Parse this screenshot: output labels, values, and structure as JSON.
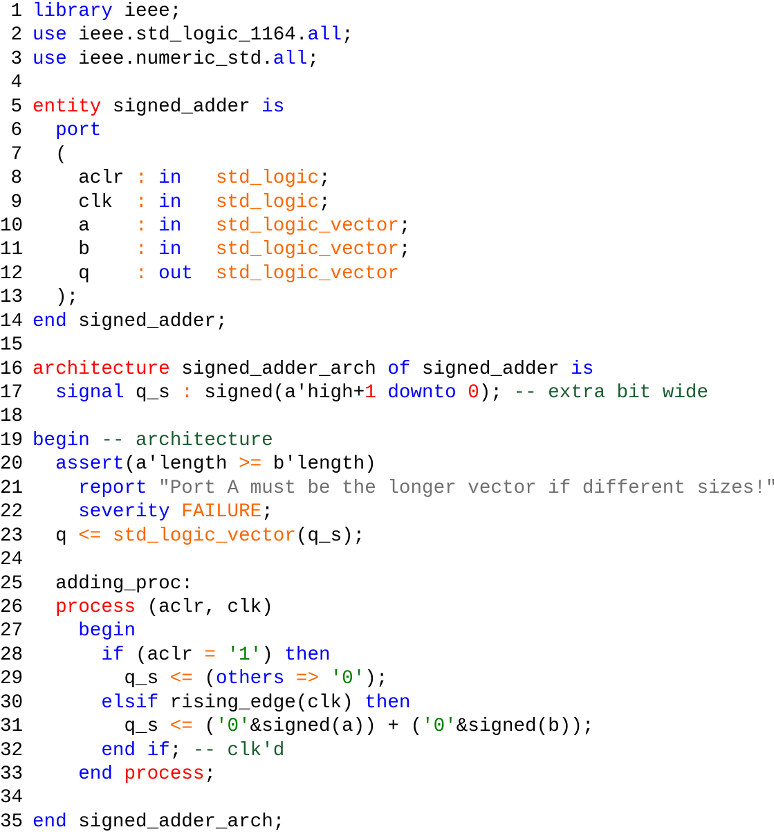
{
  "editor": {
    "language": "VHDL",
    "colors": {
      "keyword": "#0000ff",
      "design_unit_keyword": "#ff0000",
      "type": "#ff6600",
      "operator": "#ff6600",
      "number": "#ff0000",
      "comment": "#1a5c2e",
      "string": "#707070",
      "char_literal": "#008000",
      "plain": "#000000"
    },
    "lines": [
      {
        "n": "1",
        "tokens": [
          [
            "kw",
            "library"
          ],
          [
            "id",
            " ieee;"
          ]
        ]
      },
      {
        "n": "2",
        "tokens": [
          [
            "kw",
            "use"
          ],
          [
            "id",
            " ieee.std_logic_1164."
          ],
          [
            "kw",
            "all"
          ],
          [
            "id",
            ";"
          ]
        ]
      },
      {
        "n": "3",
        "tokens": [
          [
            "kw",
            "use"
          ],
          [
            "id",
            " ieee.numeric_std."
          ],
          [
            "kw",
            "all"
          ],
          [
            "id",
            ";"
          ]
        ]
      },
      {
        "n": "4",
        "tokens": []
      },
      {
        "n": "5",
        "tokens": [
          [
            "kw2",
            "entity"
          ],
          [
            "id",
            " signed_adder "
          ],
          [
            "kw",
            "is"
          ]
        ]
      },
      {
        "n": "6",
        "tokens": [
          [
            "id",
            "  "
          ],
          [
            "kw",
            "port"
          ]
        ]
      },
      {
        "n": "7",
        "tokens": [
          [
            "id",
            "  ("
          ]
        ]
      },
      {
        "n": "8",
        "tokens": [
          [
            "id",
            "    aclr "
          ],
          [
            "op",
            ":"
          ],
          [
            "id",
            " "
          ],
          [
            "kw",
            "in"
          ],
          [
            "id",
            "   "
          ],
          [
            "ty",
            "std_logic"
          ],
          [
            "id",
            ";"
          ]
        ]
      },
      {
        "n": "9",
        "tokens": [
          [
            "id",
            "    clk  "
          ],
          [
            "op",
            ":"
          ],
          [
            "id",
            " "
          ],
          [
            "kw",
            "in"
          ],
          [
            "id",
            "   "
          ],
          [
            "ty",
            "std_logic"
          ],
          [
            "id",
            ";"
          ]
        ]
      },
      {
        "n": "10",
        "tokens": [
          [
            "id",
            "    a    "
          ],
          [
            "op",
            ":"
          ],
          [
            "id",
            " "
          ],
          [
            "kw",
            "in"
          ],
          [
            "id",
            "   "
          ],
          [
            "ty",
            "std_logic_vector"
          ],
          [
            "id",
            ";"
          ]
        ]
      },
      {
        "n": "11",
        "tokens": [
          [
            "id",
            "    b    "
          ],
          [
            "op",
            ":"
          ],
          [
            "id",
            " "
          ],
          [
            "kw",
            "in"
          ],
          [
            "id",
            "   "
          ],
          [
            "ty",
            "std_logic_vector"
          ],
          [
            "id",
            ";"
          ]
        ]
      },
      {
        "n": "12",
        "tokens": [
          [
            "id",
            "    q    "
          ],
          [
            "op",
            ":"
          ],
          [
            "id",
            " "
          ],
          [
            "kw",
            "out"
          ],
          [
            "id",
            "  "
          ],
          [
            "ty",
            "std_logic_vector"
          ]
        ]
      },
      {
        "n": "13",
        "tokens": [
          [
            "id",
            "  );"
          ]
        ]
      },
      {
        "n": "14",
        "tokens": [
          [
            "kw",
            "end"
          ],
          [
            "id",
            " signed_adder;"
          ]
        ]
      },
      {
        "n": "15",
        "tokens": []
      },
      {
        "n": "16",
        "tokens": [
          [
            "kw2",
            "architecture"
          ],
          [
            "id",
            " signed_adder_arch "
          ],
          [
            "kw",
            "of"
          ],
          [
            "id",
            " signed_adder "
          ],
          [
            "kw",
            "is"
          ]
        ]
      },
      {
        "n": "17",
        "tokens": [
          [
            "id",
            "  "
          ],
          [
            "kw",
            "signal"
          ],
          [
            "id",
            " q_s "
          ],
          [
            "op",
            ":"
          ],
          [
            "id",
            " signed(a'high+"
          ],
          [
            "num",
            "1"
          ],
          [
            "id",
            " "
          ],
          [
            "kw",
            "downto"
          ],
          [
            "id",
            " "
          ],
          [
            "num",
            "0"
          ],
          [
            "id",
            "); "
          ],
          [
            "cm",
            "-- extra bit wide"
          ]
        ]
      },
      {
        "n": "18",
        "tokens": []
      },
      {
        "n": "19",
        "tokens": [
          [
            "kw",
            "begin"
          ],
          [
            "id",
            " "
          ],
          [
            "cm",
            "-- architecture"
          ]
        ]
      },
      {
        "n": "20",
        "tokens": [
          [
            "id",
            "  "
          ],
          [
            "kw",
            "assert"
          ],
          [
            "id",
            "(a'length "
          ],
          [
            "op",
            ">="
          ],
          [
            "id",
            " b'length)"
          ]
        ]
      },
      {
        "n": "21",
        "tokens": [
          [
            "id",
            "    "
          ],
          [
            "kw",
            "report"
          ],
          [
            "id",
            " "
          ],
          [
            "str",
            "\"Port A must be the longer vector if different sizes!\""
          ]
        ]
      },
      {
        "n": "22",
        "tokens": [
          [
            "id",
            "    "
          ],
          [
            "kw",
            "severity"
          ],
          [
            "id",
            " "
          ],
          [
            "ty",
            "FAILURE"
          ],
          [
            "id",
            ";"
          ]
        ]
      },
      {
        "n": "23",
        "tokens": [
          [
            "id",
            "  q "
          ],
          [
            "op",
            "<="
          ],
          [
            "id",
            " "
          ],
          [
            "ty",
            "std_logic_vector"
          ],
          [
            "id",
            "(q_s);"
          ]
        ]
      },
      {
        "n": "24",
        "tokens": []
      },
      {
        "n": "25",
        "tokens": [
          [
            "id",
            "  adding_proc:"
          ]
        ]
      },
      {
        "n": "26",
        "tokens": [
          [
            "id",
            "  "
          ],
          [
            "kw2",
            "process"
          ],
          [
            "id",
            " (aclr, clk)"
          ]
        ]
      },
      {
        "n": "27",
        "tokens": [
          [
            "id",
            "    "
          ],
          [
            "kw",
            "begin"
          ]
        ]
      },
      {
        "n": "28",
        "tokens": [
          [
            "id",
            "      "
          ],
          [
            "kw",
            "if"
          ],
          [
            "id",
            " (aclr "
          ],
          [
            "op",
            "="
          ],
          [
            "id",
            " "
          ],
          [
            "chr",
            "'1'"
          ],
          [
            "id",
            ") "
          ],
          [
            "kw",
            "then"
          ]
        ]
      },
      {
        "n": "29",
        "tokens": [
          [
            "id",
            "        q_s "
          ],
          [
            "op",
            "<="
          ],
          [
            "id",
            " ("
          ],
          [
            "kw",
            "others"
          ],
          [
            "id",
            " "
          ],
          [
            "op",
            "=>"
          ],
          [
            "id",
            " "
          ],
          [
            "chr",
            "'0'"
          ],
          [
            "id",
            ");"
          ]
        ]
      },
      {
        "n": "30",
        "tokens": [
          [
            "id",
            "      "
          ],
          [
            "kw",
            "elsif"
          ],
          [
            "id",
            " rising_edge(clk) "
          ],
          [
            "kw",
            "then"
          ]
        ]
      },
      {
        "n": "31",
        "tokens": [
          [
            "id",
            "        q_s "
          ],
          [
            "op",
            "<="
          ],
          [
            "id",
            " ("
          ],
          [
            "chr",
            "'0'"
          ],
          [
            "id",
            "&signed(a)) + ("
          ],
          [
            "chr",
            "'0'"
          ],
          [
            "id",
            "&signed(b));"
          ]
        ]
      },
      {
        "n": "32",
        "tokens": [
          [
            "id",
            "      "
          ],
          [
            "kw",
            "end"
          ],
          [
            "id",
            " "
          ],
          [
            "kw",
            "if"
          ],
          [
            "id",
            "; "
          ],
          [
            "cm",
            "-- clk'd"
          ]
        ]
      },
      {
        "n": "33",
        "tokens": [
          [
            "id",
            "    "
          ],
          [
            "kw",
            "end"
          ],
          [
            "id",
            " "
          ],
          [
            "kw2",
            "process"
          ],
          [
            "id",
            ";"
          ]
        ]
      },
      {
        "n": "34",
        "tokens": []
      },
      {
        "n": "35",
        "tokens": [
          [
            "kw",
            "end"
          ],
          [
            "id",
            " signed_adder_arch;"
          ]
        ]
      }
    ]
  }
}
